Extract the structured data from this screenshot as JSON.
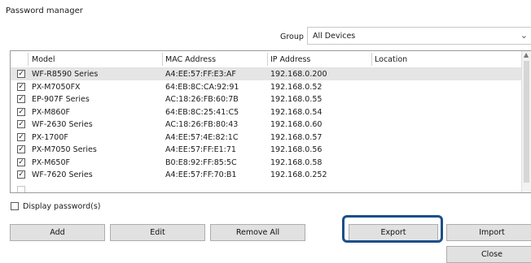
{
  "window": {
    "title": "Password manager"
  },
  "group": {
    "label": "Group",
    "value": "All Devices"
  },
  "table": {
    "columns": [
      "Model",
      "MAC Address",
      "IP Address",
      "Location"
    ],
    "rows": [
      {
        "checked": true,
        "model": "WF-R8590 Series",
        "mac": "A4:EE:57:FF:E3:AF",
        "ip": "192.168.0.200",
        "location": ""
      },
      {
        "checked": true,
        "model": "PX-M7050FX",
        "mac": "64:EB:8C:CA:92:91",
        "ip": "192.168.0.52",
        "location": ""
      },
      {
        "checked": true,
        "model": "EP-907F Series",
        "mac": "AC:18:26:FB:60:7B",
        "ip": "192.168.0.55",
        "location": ""
      },
      {
        "checked": true,
        "model": "PX-M860F",
        "mac": "64:EB:8C:25:41:C5",
        "ip": "192.168.0.54",
        "location": ""
      },
      {
        "checked": true,
        "model": "WF-2630 Series",
        "mac": "AC:18:26:FB:80:43",
        "ip": "192.168.0.60",
        "location": ""
      },
      {
        "checked": true,
        "model": "PX-1700F",
        "mac": "A4:EE:57:4E:82:1C",
        "ip": "192.168.0.57",
        "location": ""
      },
      {
        "checked": true,
        "model": "PX-M7050 Series",
        "mac": "A4:EE:57:FF:E1:71",
        "ip": "192.168.0.56",
        "location": ""
      },
      {
        "checked": true,
        "model": "PX-M650F",
        "mac": "B0:E8:92:FF:85:5C",
        "ip": "192.168.0.58",
        "location": ""
      },
      {
        "checked": true,
        "model": "WF-7620 Series",
        "mac": "A4:EE:57:FF:70:B1",
        "ip": "192.168.0.252",
        "location": ""
      }
    ],
    "selected_row": 0
  },
  "display_password": {
    "label": "Display password(s)",
    "checked": false
  },
  "buttons": {
    "add": "Add",
    "edit": "Edit",
    "remove_all": "Remove All",
    "export": "Export",
    "import": "Import",
    "close": "Close"
  },
  "colors": {
    "highlight_border": "#1c4f8a",
    "button_bg": "#e1e1e1",
    "selected_row_bg": "#e5e5e5"
  },
  "icons": {
    "checkbox_checked": "check-mark",
    "group_dropdown": "chevron-down-icon",
    "scroll_up": "scroll-up-icon"
  }
}
